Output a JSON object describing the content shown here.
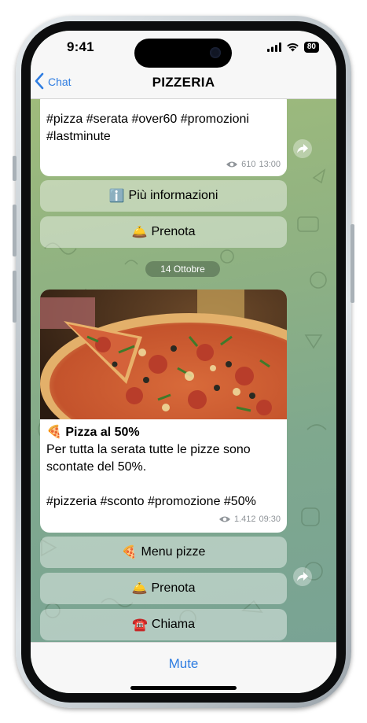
{
  "status_bar": {
    "time": "9:41",
    "battery": "80"
  },
  "nav": {
    "back_label": "Chat",
    "title": "PIZZERIA"
  },
  "messages": [
    {
      "text_lines": [
        "#pizza #serata #over60 #promozioni",
        "#lastminute"
      ],
      "views": "610",
      "time": "13:00",
      "buttons": [
        {
          "emoji": "ℹ️",
          "label": "Più informazioni"
        },
        {
          "emoji": "🛎️",
          "label": "Prenota"
        }
      ]
    },
    {
      "date": "14 Ottobre",
      "heading_emoji": "🍕",
      "heading": "Pizza al 50%",
      "body_lines": [
        "Per tutta la serata tutte le pizze sono",
        "scontate del 50%."
      ],
      "hashtags": "#pizzeria #sconto #promozione #50%",
      "views": "1.412",
      "time": "09:30",
      "buttons": [
        {
          "emoji": "🍕",
          "label": "Menu pizze"
        },
        {
          "emoji": "🛎️",
          "label": "Prenota"
        },
        {
          "emoji": "☎️",
          "label": "Chiama"
        }
      ]
    }
  ],
  "bottom_bar": {
    "mute_label": "Mute"
  },
  "colors": {
    "accent": "#2f7de1",
    "chat_top": "#9fbb7b",
    "chat_bottom": "#79a394"
  }
}
